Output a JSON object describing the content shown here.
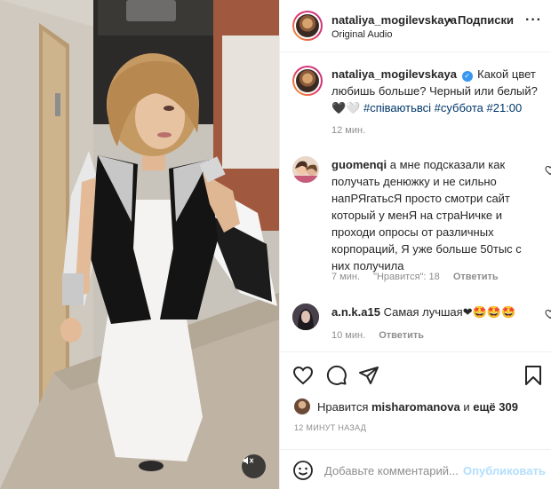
{
  "media": {
    "description_icon": "mute-icon",
    "colors": {
      "wall": "#d5d0c7",
      "floor": "#c7bcae",
      "door": "#c8b08a",
      "jacket": "#1a1a1a",
      "dress": "#f3f2f0"
    }
  },
  "header": {
    "username": "nataliya_mogilevskaya",
    "dot": "•",
    "follow_label": "Подписки",
    "audio": "Original Audio",
    "more_icon": "more-icon",
    "more_glyph": "···"
  },
  "caption": {
    "username": "nataliya_mogilevskaya",
    "text": "Какой цвет любишь больше? Черный или белый?",
    "hearts": "🖤🤍",
    "hashtags": [
      "#співаютьвсі",
      "#суббота",
      "#21:00"
    ],
    "time": "12 мин."
  },
  "comments": [
    {
      "username": "guomenqi",
      "text": "а мне подсказали как получать денюжку и не сильно напРЯгатьсЯ просто смотри сайт который у менЯ на страНичке и проходи опросы от различных корпораций, Я уже больше 50тыс с них получила",
      "time": "7 мин.",
      "likes": "\"Нравится\": 18",
      "reply": "Ответить"
    },
    {
      "username": "a.n.k.a15",
      "text": "Самая лучшая",
      "emoji": "❤🤩🤩🤩",
      "time": "10 мин.",
      "reply": "Ответить"
    }
  ],
  "likes": {
    "prefix": "Нравится",
    "user": "misharomanova",
    "middle": "и",
    "rest": "ещё 309"
  },
  "post_time": "12 МИНУТ НАЗАД",
  "add_comment": {
    "placeholder": "Добавьте комментарий...",
    "publish": "Опубликовать"
  }
}
